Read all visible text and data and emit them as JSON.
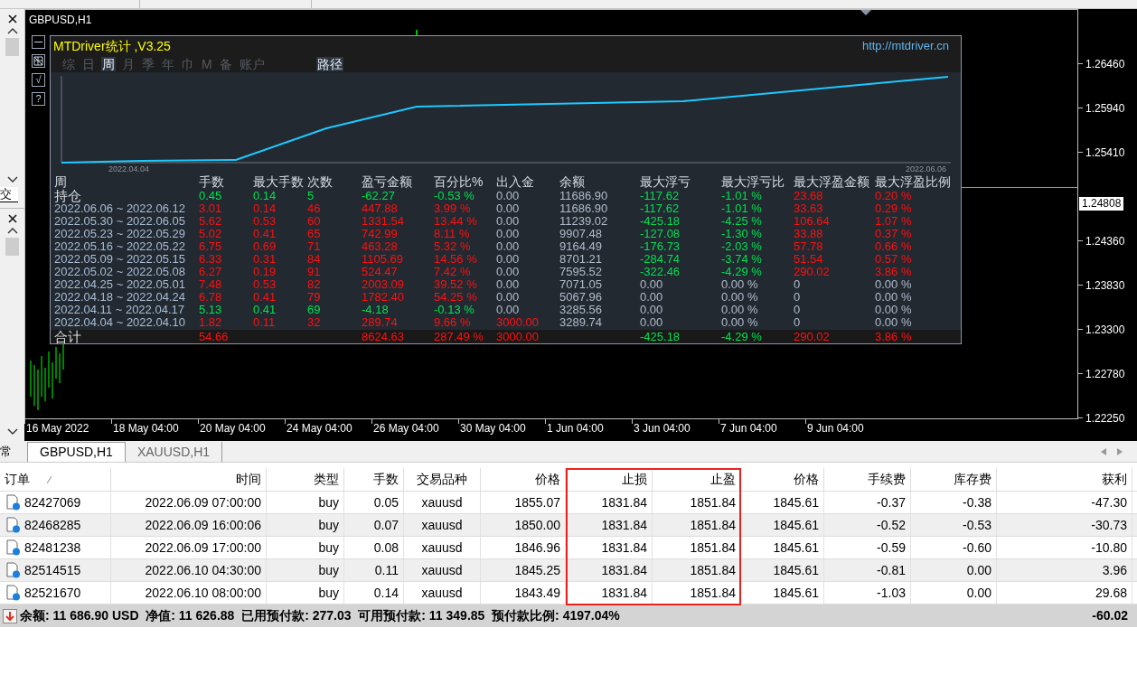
{
  "left_panel": {
    "upper_label": "交",
    "lower_label": "常"
  },
  "chart": {
    "title": "GBPUSD,H1",
    "price_labels": [
      "1.26460",
      "1.25940",
      "1.25410",
      "1.24360",
      "1.23830",
      "1.23300",
      "1.22780",
      "1.22250"
    ],
    "current_price": "1.24808",
    "time_labels": [
      "16 May 2022",
      "18 May 04:00",
      "20 May 04:00",
      "24 May 04:00",
      "26 May 04:00",
      "30 May 04:00",
      "1 Jun 04:00",
      "3 Jun 04:00",
      "7 Jun 04:00",
      "9 Jun 04:00"
    ]
  },
  "stats_panel": {
    "title": "MTDriver统计 ,V3.25",
    "url": "http://mtdriver.cn",
    "side_buttons": [
      "√",
      "?"
    ],
    "tabs": [
      {
        "label": "综",
        "selected": false
      },
      {
        "label": "日",
        "selected": false
      },
      {
        "label": "周",
        "selected": true
      },
      {
        "label": "月",
        "selected": false
      },
      {
        "label": "季",
        "selected": false
      },
      {
        "label": "年",
        "selected": false
      },
      {
        "label": "巾",
        "selected": false
      },
      {
        "label": "M",
        "selected": false
      },
      {
        "label": "备",
        "selected": false
      },
      {
        "label": "账户",
        "selected": false
      }
    ],
    "path_button": "路径",
    "equity_chart": {
      "start_label": "2022.04.04",
      "end_label": "2022.06.06"
    },
    "columns": [
      "周",
      "手数",
      "最大手数",
      "次数",
      "盈亏金额",
      "百分比%",
      "出入金",
      "余额",
      "最大浮亏",
      "最大浮亏比",
      "最大浮盈金额",
      "最大浮盈比例"
    ],
    "rows": [
      {
        "cells": [
          {
            "text": "持仓",
            "color": "#d8dde3"
          },
          {
            "text": "0.45",
            "color": "#00e050"
          },
          {
            "text": "0.14",
            "color": "#00e050"
          },
          {
            "text": "5",
            "color": "#00e050"
          },
          {
            "text": "-62.27",
            "color": "#00e050"
          },
          {
            "text": "-0.53 %",
            "color": "#00e050"
          },
          {
            "text": "0.00",
            "color": "#b0bccb"
          },
          {
            "text": "11686.90",
            "color": "#b0bccb"
          },
          {
            "text": "-117.62",
            "color": "#00e050"
          },
          {
            "text": "-1.01 %",
            "color": "#00e050"
          },
          {
            "text": "23.68",
            "color": "#ff1010"
          },
          {
            "text": "0.20 %",
            "color": "#ff1010"
          }
        ]
      },
      {
        "cells": [
          {
            "text": "2022.06.06 ~ 2022.06.12",
            "color": "#a9bdd6"
          },
          {
            "text": "3.01",
            "color": "#ff1010"
          },
          {
            "text": "0.14",
            "color": "#ff1010"
          },
          {
            "text": "46",
            "color": "#ff1010"
          },
          {
            "text": "447.88",
            "color": "#ff1010"
          },
          {
            "text": "3.99 %",
            "color": "#ff1010"
          },
          {
            "text": "0.00",
            "color": "#b0bccb"
          },
          {
            "text": "11686.90",
            "color": "#b0bccb"
          },
          {
            "text": "-117.62",
            "color": "#00e050"
          },
          {
            "text": "-1.01 %",
            "color": "#00e050"
          },
          {
            "text": "33.63",
            "color": "#ff1010"
          },
          {
            "text": "0.29 %",
            "color": "#ff1010"
          }
        ]
      },
      {
        "cells": [
          {
            "text": "2022.05.30 ~ 2022.06.05",
            "color": "#a9bdd6"
          },
          {
            "text": "5.62",
            "color": "#ff1010"
          },
          {
            "text": "0.53",
            "color": "#ff1010"
          },
          {
            "text": "60",
            "color": "#ff1010"
          },
          {
            "text": "1331.54",
            "color": "#ff1010"
          },
          {
            "text": "13.44 %",
            "color": "#ff1010"
          },
          {
            "text": "0.00",
            "color": "#b0bccb"
          },
          {
            "text": "11239.02",
            "color": "#b0bccb"
          },
          {
            "text": "-425.18",
            "color": "#00e050"
          },
          {
            "text": "-4.25 %",
            "color": "#00e050"
          },
          {
            "text": "106.64",
            "color": "#ff1010"
          },
          {
            "text": "1.07 %",
            "color": "#ff1010"
          }
        ]
      },
      {
        "cells": [
          {
            "text": "2022.05.23 ~ 2022.05.29",
            "color": "#a9bdd6"
          },
          {
            "text": "5.02",
            "color": "#ff1010"
          },
          {
            "text": "0.41",
            "color": "#ff1010"
          },
          {
            "text": "65",
            "color": "#ff1010"
          },
          {
            "text": "742.99",
            "color": "#ff1010"
          },
          {
            "text": "8.11 %",
            "color": "#ff1010"
          },
          {
            "text": "0.00",
            "color": "#b0bccb"
          },
          {
            "text": "9907.48",
            "color": "#b0bccb"
          },
          {
            "text": "-127.08",
            "color": "#00e050"
          },
          {
            "text": "-1.30 %",
            "color": "#00e050"
          },
          {
            "text": "33.88",
            "color": "#ff1010"
          },
          {
            "text": "0.37 %",
            "color": "#ff1010"
          }
        ]
      },
      {
        "cells": [
          {
            "text": "2022.05.16 ~ 2022.05.22",
            "color": "#a9bdd6"
          },
          {
            "text": "6.75",
            "color": "#ff1010"
          },
          {
            "text": "0.69",
            "color": "#ff1010"
          },
          {
            "text": "71",
            "color": "#ff1010"
          },
          {
            "text": "463.28",
            "color": "#ff1010"
          },
          {
            "text": "5.32 %",
            "color": "#ff1010"
          },
          {
            "text": "0.00",
            "color": "#b0bccb"
          },
          {
            "text": "9164.49",
            "color": "#b0bccb"
          },
          {
            "text": "-176.73",
            "color": "#00e050"
          },
          {
            "text": "-2.03 %",
            "color": "#00e050"
          },
          {
            "text": "57.78",
            "color": "#ff1010"
          },
          {
            "text": "0.66 %",
            "color": "#ff1010"
          }
        ]
      },
      {
        "cells": [
          {
            "text": "2022.05.09 ~ 2022.05.15",
            "color": "#a9bdd6"
          },
          {
            "text": "6.33",
            "color": "#ff1010"
          },
          {
            "text": "0.31",
            "color": "#ff1010"
          },
          {
            "text": "84",
            "color": "#ff1010"
          },
          {
            "text": "1105.69",
            "color": "#ff1010"
          },
          {
            "text": "14.56 %",
            "color": "#ff1010"
          },
          {
            "text": "0.00",
            "color": "#b0bccb"
          },
          {
            "text": "8701.21",
            "color": "#b0bccb"
          },
          {
            "text": "-284.74",
            "color": "#00e050"
          },
          {
            "text": "-3.74 %",
            "color": "#00e050"
          },
          {
            "text": "51.54",
            "color": "#ff1010"
          },
          {
            "text": "0.57 %",
            "color": "#ff1010"
          }
        ]
      },
      {
        "cells": [
          {
            "text": "2022.05.02 ~ 2022.05.08",
            "color": "#a9bdd6"
          },
          {
            "text": "6.27",
            "color": "#ff1010"
          },
          {
            "text": "0.19",
            "color": "#ff1010"
          },
          {
            "text": "91",
            "color": "#ff1010"
          },
          {
            "text": "524.47",
            "color": "#ff1010"
          },
          {
            "text": "7.42 %",
            "color": "#ff1010"
          },
          {
            "text": "0.00",
            "color": "#b0bccb"
          },
          {
            "text": "7595.52",
            "color": "#b0bccb"
          },
          {
            "text": "-322.46",
            "color": "#00e050"
          },
          {
            "text": "-4.29 %",
            "color": "#00e050"
          },
          {
            "text": "290.02",
            "color": "#ff1010"
          },
          {
            "text": "3.86 %",
            "color": "#ff1010"
          }
        ]
      },
      {
        "cells": [
          {
            "text": "2022.04.25 ~ 2022.05.01",
            "color": "#a9bdd6"
          },
          {
            "text": "7.48",
            "color": "#ff1010"
          },
          {
            "text": "0.53",
            "color": "#ff1010"
          },
          {
            "text": "82",
            "color": "#ff1010"
          },
          {
            "text": "2003.09",
            "color": "#ff1010"
          },
          {
            "text": "39.52 %",
            "color": "#ff1010"
          },
          {
            "text": "0.00",
            "color": "#b0bccb"
          },
          {
            "text": "7071.05",
            "color": "#b0bccb"
          },
          {
            "text": "0.00",
            "color": "#b0bccb"
          },
          {
            "text": "0.00 %",
            "color": "#b0bccb"
          },
          {
            "text": "0",
            "color": "#b0bccb"
          },
          {
            "text": "0.00 %",
            "color": "#b0bccb"
          }
        ]
      },
      {
        "cells": [
          {
            "text": "2022.04.18 ~ 2022.04.24",
            "color": "#a9bdd6"
          },
          {
            "text": "6.78",
            "color": "#ff1010"
          },
          {
            "text": "0.41",
            "color": "#ff1010"
          },
          {
            "text": "79",
            "color": "#ff1010"
          },
          {
            "text": "1782.40",
            "color": "#ff1010"
          },
          {
            "text": "54.25 %",
            "color": "#ff1010"
          },
          {
            "text": "0.00",
            "color": "#b0bccb"
          },
          {
            "text": "5067.96",
            "color": "#b0bccb"
          },
          {
            "text": "0.00",
            "color": "#b0bccb"
          },
          {
            "text": "0.00 %",
            "color": "#b0bccb"
          },
          {
            "text": "0",
            "color": "#b0bccb"
          },
          {
            "text": "0.00 %",
            "color": "#b0bccb"
          }
        ]
      },
      {
        "cells": [
          {
            "text": "2022.04.11 ~ 2022.04.17",
            "color": "#a9bdd6"
          },
          {
            "text": "5.13",
            "color": "#00e050"
          },
          {
            "text": "0.41",
            "color": "#00e050"
          },
          {
            "text": "69",
            "color": "#00e050"
          },
          {
            "text": "-4.18",
            "color": "#00e050"
          },
          {
            "text": "-0.13 %",
            "color": "#00e050"
          },
          {
            "text": "0.00",
            "color": "#b0bccb"
          },
          {
            "text": "3285.56",
            "color": "#b0bccb"
          },
          {
            "text": "0.00",
            "color": "#b0bccb"
          },
          {
            "text": "0.00 %",
            "color": "#b0bccb"
          },
          {
            "text": "0",
            "color": "#b0bccb"
          },
          {
            "text": "0.00 %",
            "color": "#b0bccb"
          }
        ]
      },
      {
        "cells": [
          {
            "text": "2022.04.04 ~ 2022.04.10",
            "color": "#a9bdd6"
          },
          {
            "text": "1.82",
            "color": "#ff1010"
          },
          {
            "text": "0.11",
            "color": "#ff1010"
          },
          {
            "text": "32",
            "color": "#ff1010"
          },
          {
            "text": "289.74",
            "color": "#ff1010"
          },
          {
            "text": "9.66 %",
            "color": "#ff1010"
          },
          {
            "text": "3000.00",
            "color": "#ff1010"
          },
          {
            "text": "3289.74",
            "color": "#b0bccb"
          },
          {
            "text": "0.00",
            "color": "#b0bccb"
          },
          {
            "text": "0.00 %",
            "color": "#b0bccb"
          },
          {
            "text": "0",
            "color": "#b0bccb"
          },
          {
            "text": "0.00 %",
            "color": "#b0bccb"
          }
        ]
      }
    ],
    "total": {
      "cells": [
        {
          "text": "合计",
          "color": "#d8dde3"
        },
        {
          "text": "54.66",
          "color": "#ff1010"
        },
        null,
        null,
        {
          "text": "8624.63",
          "color": "#ff1010"
        },
        {
          "text": "287.49 %",
          "color": "#ff1010"
        },
        {
          "text": "3000.00",
          "color": "#ff1010"
        },
        null,
        {
          "text": "-425.18",
          "color": "#00e050"
        },
        {
          "text": "-4.29 %",
          "color": "#00e050"
        },
        {
          "text": "290.02",
          "color": "#ff1010"
        },
        {
          "text": "3.86 %",
          "color": "#ff1010"
        }
      ]
    }
  },
  "chart_tabs": [
    {
      "label": "GBPUSD,H1",
      "selected": true
    },
    {
      "label": "XAUUSD,H1",
      "selected": false
    }
  ],
  "orders": {
    "columns": [
      {
        "label": "订单",
        "highlighted": false
      },
      {
        "label": "时间",
        "highlighted": false
      },
      {
        "label": "类型",
        "highlighted": false
      },
      {
        "label": "手数",
        "highlighted": false
      },
      {
        "label": "交易品种",
        "highlighted": false
      },
      {
        "label": "价格",
        "highlighted": false
      },
      {
        "label": "止损",
        "highlighted": true
      },
      {
        "label": "止盈",
        "highlighted": true
      },
      {
        "label": "价格",
        "highlighted": false
      },
      {
        "label": "手续费",
        "highlighted": false
      },
      {
        "label": "库存费",
        "highlighted": false
      },
      {
        "label": "获利",
        "highlighted": false
      }
    ],
    "rows": [
      {
        "order": "82427069",
        "time": "2022.06.09 07:00:00",
        "type": "buy",
        "lots": "0.05",
        "symbol": "xauusd",
        "open_price": "1855.07",
        "sl": "1831.84",
        "tp": "1851.84",
        "price": "1845.61",
        "commission": "-0.37",
        "swap": "-0.38",
        "profit": "-47.30"
      },
      {
        "order": "82468285",
        "time": "2022.06.09 16:00:06",
        "type": "buy",
        "lots": "0.07",
        "symbol": "xauusd",
        "open_price": "1850.00",
        "sl": "1831.84",
        "tp": "1851.84",
        "price": "1845.61",
        "commission": "-0.52",
        "swap": "-0.53",
        "profit": "-30.73"
      },
      {
        "order": "82481238",
        "time": "2022.06.09 17:00:00",
        "type": "buy",
        "lots": "0.08",
        "symbol": "xauusd",
        "open_price": "1846.96",
        "sl": "1831.84",
        "tp": "1851.84",
        "price": "1845.61",
        "commission": "-0.59",
        "swap": "-0.60",
        "profit": "-10.80"
      },
      {
        "order": "82514515",
        "time": "2022.06.10 04:30:00",
        "type": "buy",
        "lots": "0.11",
        "symbol": "xauusd",
        "open_price": "1845.25",
        "sl": "1831.84",
        "tp": "1851.84",
        "price": "1845.61",
        "commission": "-0.81",
        "swap": "0.00",
        "profit": "3.96"
      },
      {
        "order": "82521670",
        "time": "2022.06.10 08:00:00",
        "type": "buy",
        "lots": "0.14",
        "symbol": "xauusd",
        "open_price": "1843.49",
        "sl": "1831.84",
        "tp": "1851.84",
        "price": "1845.61",
        "commission": "-1.03",
        "swap": "0.00",
        "profit": "29.68"
      }
    ],
    "summary": {
      "text": "余额: 11 686.90 USD  净值: 11 626.88  已用预付款: 277.03  可用预付款: 11 349.85  预付款比例: 4197.04%",
      "profit": "-60.02"
    }
  }
}
